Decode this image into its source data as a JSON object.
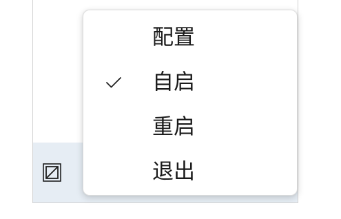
{
  "menu": {
    "items": [
      {
        "label": "配置",
        "checked": false
      },
      {
        "label": "自启",
        "checked": true
      },
      {
        "label": "重启",
        "checked": false
      },
      {
        "label": "退出",
        "checked": false
      }
    ]
  },
  "icons": {
    "checkmark": "check-icon",
    "tray": "tray-app-icon"
  },
  "colors": {
    "menu_background": "#ffffff",
    "taskbar_background": "#e6edf4",
    "text": "#1a1a1a"
  }
}
